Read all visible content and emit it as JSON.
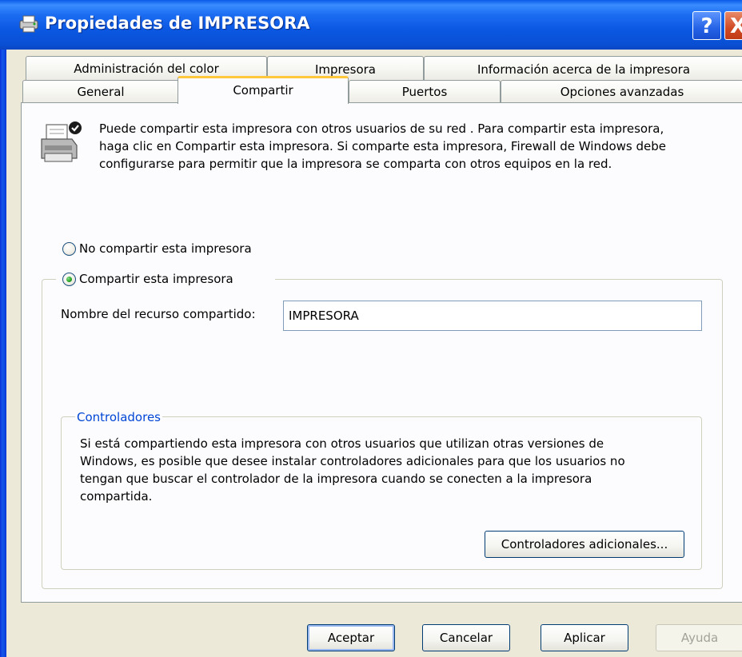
{
  "window": {
    "title": "Propiedades de IMPRESORA",
    "help_label": "?",
    "close_label": "X"
  },
  "tabs": {
    "row_back": [
      "Administración del color",
      "Impresora",
      "Información acerca de la impresora"
    ],
    "row_front": [
      "General",
      "Compartir",
      "Puertos",
      "Opciones avanzadas"
    ],
    "selected": "Compartir"
  },
  "sharing": {
    "info_lines": [
      "Puede compartir esta impresora con otros usuarios de su red . Para compartir esta impresora,",
      "haga clic en Compartir esta impresora.  Si comparte esta impresora, Firewall de Windows debe",
      "configurarse para permitir que la impresora se comparta con otros equipos en la red."
    ],
    "no_share_label": "No compartir esta impresora",
    "share_label": "Compartir esta impresora",
    "selected_option": "share",
    "share_name_label": "Nombre del recurso compartido:",
    "share_name_value": "IMPRESORA"
  },
  "drivers": {
    "title": "Controladores",
    "text_lines": [
      "Si está compartiendo esta impresora con otros usuarios que utilizan otras versiones de",
      "Windows, es posible que desee instalar controladores adicionales para que los usuarios no",
      "tengan que buscar el controlador de la impresora cuando se conecten a la impresora",
      "compartida."
    ],
    "button_label": "Controladores adicionales..."
  },
  "footer": {
    "ok_label": "Aceptar",
    "cancel_label": "Cancelar",
    "apply_label": "Aplicar",
    "help_label": "Ayuda"
  },
  "colors": {
    "titlebar": "#0a5ae8",
    "selected_tab_accent": "#ffc83c",
    "group_title": "#0046d5",
    "radio_dot": "#21a121"
  }
}
